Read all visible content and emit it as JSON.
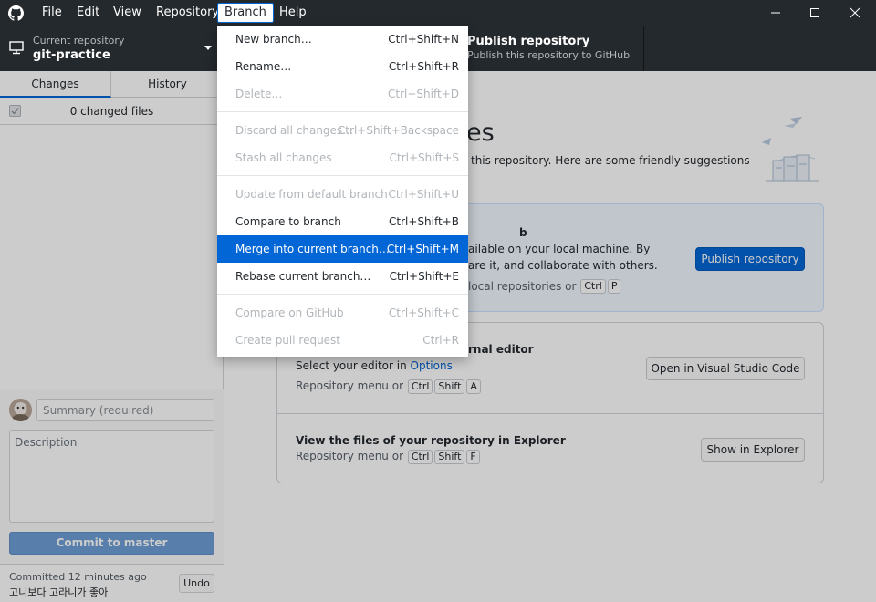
{
  "menu_bar": {
    "items": [
      "File",
      "Edit",
      "View",
      "Repository",
      "Branch",
      "Help"
    ],
    "active": "Branch"
  },
  "toolbar": {
    "current_repo_label": "Current repository",
    "current_repo_value": "git-practice",
    "publish_title": "Publish repository",
    "publish_subtitle": "Publish this repository to GitHub"
  },
  "sidebar": {
    "tabs": [
      "Changes",
      "History"
    ],
    "changed_files": "0 changed files",
    "summary_placeholder": "Summary (required)",
    "description_placeholder": "Description",
    "commit_button": "Commit to master",
    "last_commit_time": "Committed 12 minutes ago",
    "last_commit_message": "고니보다 고라니가 좋아",
    "undo": "Undo"
  },
  "main": {
    "heading": "es",
    "subheading": "this repository. Here are some friendly suggestions",
    "publish_card": {
      "title": "b",
      "line1": "ailable on your local machine. By",
      "line2": "are it, and collaborate with others.",
      "line3": "local repositories or",
      "keys": [
        "Ctrl",
        "P"
      ],
      "button": "Publish repository"
    },
    "editor_card": {
      "title": "rnal editor",
      "subtitle_prefix": "Select your editor in",
      "subtitle_link": "Options",
      "hint": "Repository menu or",
      "keys": [
        "Ctrl",
        "Shift",
        "A"
      ],
      "button": "Open in Visual Studio Code"
    },
    "explorer_card": {
      "title": "View the files of your repository in Explorer",
      "hint": "Repository menu or",
      "keys": [
        "Ctrl",
        "Shift",
        "F"
      ],
      "button": "Show in Explorer"
    }
  },
  "branch_menu": {
    "items": [
      {
        "label": "New branch…",
        "shortcut": "Ctrl+Shift+N",
        "state": "enabled"
      },
      {
        "label": "Rename…",
        "shortcut": "Ctrl+Shift+R",
        "state": "enabled"
      },
      {
        "label": "Delete…",
        "shortcut": "Ctrl+Shift+D",
        "state": "disabled"
      },
      {
        "label": "Discard all changes…",
        "shortcut": "Ctrl+Shift+Backspace",
        "state": "disabled"
      },
      {
        "label": "Stash all changes",
        "shortcut": "Ctrl+Shift+S",
        "state": "disabled"
      },
      {
        "label": "Update from default branch",
        "shortcut": "Ctrl+Shift+U",
        "state": "disabled"
      },
      {
        "label": "Compare to branch",
        "shortcut": "Ctrl+Shift+B",
        "state": "enabled"
      },
      {
        "label": "Merge into current branch…",
        "shortcut": "Ctrl+Shift+M",
        "state": "selected"
      },
      {
        "label": "Rebase current branch…",
        "shortcut": "Ctrl+Shift+E",
        "state": "enabled"
      },
      {
        "label": "Compare on GitHub",
        "shortcut": "Ctrl+Shift+C",
        "state": "disabled"
      },
      {
        "label": "Create pull request",
        "shortcut": "Ctrl+R",
        "state": "disabled"
      }
    ]
  },
  "colors": {
    "accent": "#0366d6",
    "titlebar": "#24292e"
  }
}
